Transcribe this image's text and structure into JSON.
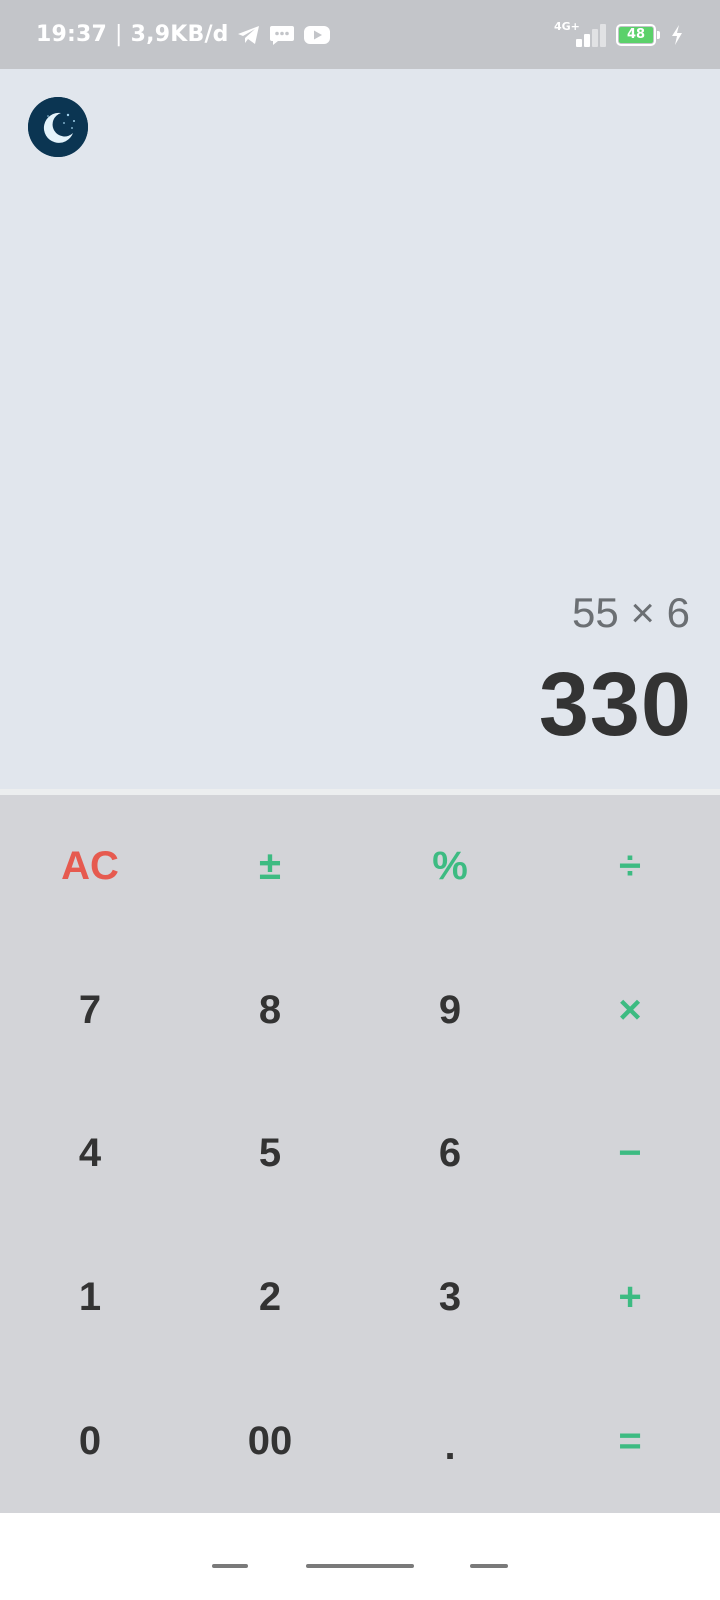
{
  "status_bar": {
    "time": "19:37",
    "separator": "|",
    "data_rate": "3,9KB/d",
    "network_label": "4G+",
    "battery_level": "48",
    "icons": [
      "telegram-icon",
      "message-icon",
      "youtube-icon",
      "signal-icon",
      "battery-icon",
      "charging-icon"
    ]
  },
  "display": {
    "theme_icon": "moon-icon",
    "expression": "55 × 6",
    "result": "330"
  },
  "keypad": {
    "rows": [
      [
        {
          "label": "AC",
          "name": "clear-button",
          "style": "red"
        },
        {
          "label": "±",
          "name": "plus-minus-button",
          "style": "green"
        },
        {
          "label": "%",
          "name": "percent-button",
          "style": "green"
        },
        {
          "label": "÷",
          "name": "divide-button",
          "style": "green"
        }
      ],
      [
        {
          "label": "7",
          "name": "key-7",
          "style": "digit"
        },
        {
          "label": "8",
          "name": "key-8",
          "style": "digit"
        },
        {
          "label": "9",
          "name": "key-9",
          "style": "digit"
        },
        {
          "label": "×",
          "name": "multiply-button",
          "style": "green"
        }
      ],
      [
        {
          "label": "4",
          "name": "key-4",
          "style": "digit"
        },
        {
          "label": "5",
          "name": "key-5",
          "style": "digit"
        },
        {
          "label": "6",
          "name": "key-6",
          "style": "digit"
        },
        {
          "label": "−",
          "name": "minus-button",
          "style": "green"
        }
      ],
      [
        {
          "label": "1",
          "name": "key-1",
          "style": "digit"
        },
        {
          "label": "2",
          "name": "key-2",
          "style": "digit"
        },
        {
          "label": "3",
          "name": "key-3",
          "style": "digit"
        },
        {
          "label": "+",
          "name": "plus-button",
          "style": "green"
        }
      ],
      [
        {
          "label": "0",
          "name": "key-0",
          "style": "digit"
        },
        {
          "label": "00",
          "name": "key-00",
          "style": "digit"
        },
        {
          "label": ".",
          "name": "decimal-button",
          "style": "digit"
        },
        {
          "label": "=",
          "name": "equals-button",
          "style": "green"
        }
      ]
    ]
  },
  "colors": {
    "status_bar_bg": "#c3c5c9",
    "display_bg": "#e1e6ed",
    "keypad_bg": "#d3d4d8",
    "clear_red": "#e65a4f",
    "operator_green": "#3dbb82",
    "digit_text": "#333333",
    "battery_green": "#5bd16a"
  }
}
